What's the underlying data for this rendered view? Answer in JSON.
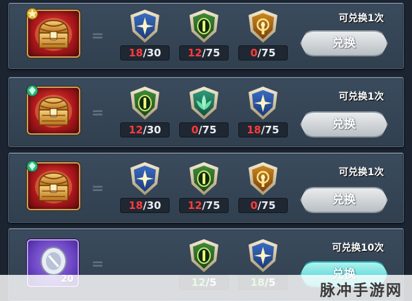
{
  "rows": [
    {
      "reward": {
        "type": "chest",
        "badge": "star-gem-icon",
        "count": ""
      },
      "equals": "=",
      "materials": [
        {
          "icon": "blue-star-emblem-icon",
          "have": "18",
          "need": "30",
          "status": "bad"
        },
        {
          "icon": "green-eye-emblem-icon",
          "have": "12",
          "need": "75",
          "status": "bad"
        },
        {
          "icon": "gold-sun-emblem-icon",
          "have": "0",
          "need": "75",
          "status": "bad"
        }
      ],
      "limit": "可兑换1次",
      "button": "兑换"
    },
    {
      "reward": {
        "type": "chest",
        "badge": "green-gem-icon",
        "count": ""
      },
      "equals": "=",
      "materials": [
        {
          "icon": "green-eye-emblem-icon",
          "have": "12",
          "need": "30",
          "status": "bad"
        },
        {
          "icon": "teal-lotus-emblem-icon",
          "have": "0",
          "need": "75",
          "status": "bad"
        },
        {
          "icon": "blue-star-emblem-icon",
          "have": "18",
          "need": "75",
          "status": "bad"
        }
      ],
      "limit": "可兑换1次",
      "button": "兑换"
    },
    {
      "reward": {
        "type": "chest",
        "badge": "green-gem-icon",
        "count": ""
      },
      "equals": "=",
      "materials": [
        {
          "icon": "blue-star-emblem-icon",
          "have": "18",
          "need": "30",
          "status": "bad"
        },
        {
          "icon": "green-eye-emblem-icon",
          "have": "12",
          "need": "75",
          "status": "bad"
        },
        {
          "icon": "gold-sun-emblem-icon",
          "have": "0",
          "need": "75",
          "status": "bad"
        }
      ],
      "limit": "可兑换1次",
      "button": "兑换"
    },
    {
      "reward": {
        "type": "crystal",
        "badge": "",
        "count": "20"
      },
      "equals": "=",
      "materials": [
        {
          "icon": "green-eye-emblem-icon",
          "have": "12",
          "need": "5",
          "status": "good"
        },
        {
          "icon": "blue-star-emblem-icon",
          "have": "18",
          "need": "5",
          "status": "good"
        }
      ],
      "limit": "可兑换10次",
      "button": "兑换"
    }
  ],
  "separator": "/",
  "watermark": "脉冲手游网",
  "colors": {
    "insufficient": "#ff3b3b",
    "sufficient": "#8be36a",
    "panel": "#34444f",
    "button_disabled": "#c8cdd1",
    "button_active": "#4fd6d8"
  }
}
